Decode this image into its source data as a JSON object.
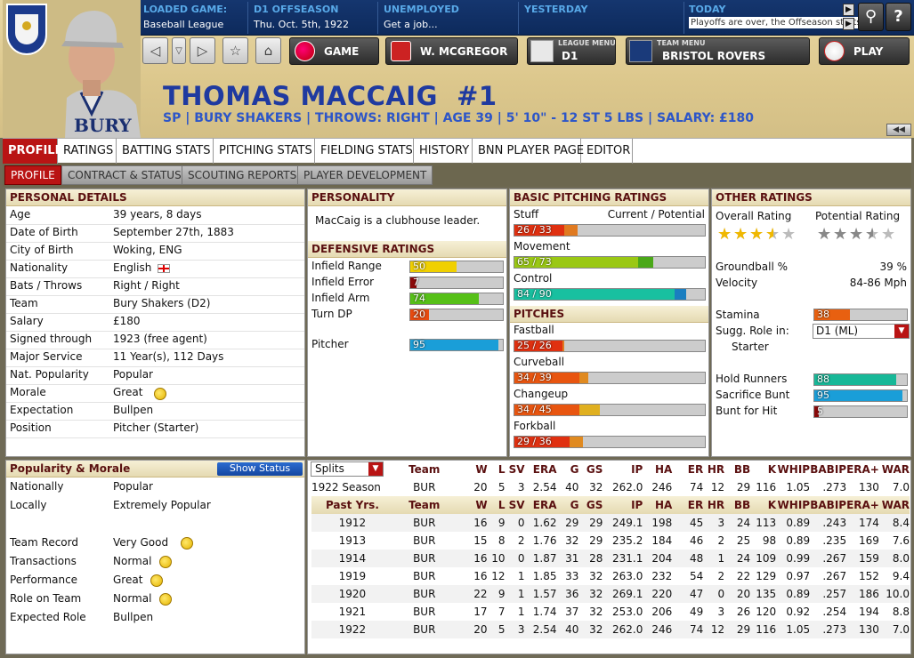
{
  "header": {
    "loaded_game_label": "LOADED GAME:",
    "loaded_game_value": "Baseball League",
    "season_label": "D1 OFFSEASON",
    "season_value": "Thu. Oct. 5th, 1922",
    "status_label": "UNEMPLOYED",
    "status_value": "Get a job...",
    "yesterday_label": "YESTERDAY",
    "today_label": "TODAY",
    "today_value": "Playoffs are over, the Offseason starts"
  },
  "nav": {
    "game": "GAME",
    "manager": "W. MCGREGOR",
    "league_menu_label": "LEAGUE MENU",
    "league_menu_value": "D1",
    "team_menu_label": "TEAM MENU",
    "team_menu_value": "BRISTOL ROVERS",
    "play": "PLAY",
    "rewind": "◀◀"
  },
  "player": {
    "name": "THOMAS MACCAIG  #1",
    "subtitle": "SP | BURY SHAKERS | THROWS: RIGHT | AGE 39 | 5' 10\" - 12 ST 5 LBS | SALARY: £180",
    "jersey_text": "BURY"
  },
  "tabs": [
    "PROFILE",
    "RATINGS",
    "BATTING STATS",
    "PITCHING STATS",
    "FIELDING STATS",
    "HISTORY",
    "BNN PLAYER PAGE",
    "EDITOR"
  ],
  "subtabs": [
    "PROFILE",
    "CONTRACT & STATUS",
    "SCOUTING REPORTS",
    "PLAYER DEVELOPMENT"
  ],
  "personal": {
    "title": "PERSONAL DETAILS",
    "rows": [
      [
        "Age",
        "39 years, 8 days"
      ],
      [
        "Date of Birth",
        "September 27th, 1883"
      ],
      [
        "City of Birth",
        "Woking, ENG"
      ],
      [
        "Nationality",
        "English"
      ],
      [
        "Bats / Throws",
        "Right / Right"
      ],
      [
        "Team",
        "Bury Shakers (D2)"
      ],
      [
        "Salary",
        "£180"
      ],
      [
        "Signed through",
        "1923 (free agent)"
      ],
      [
        "Major Service",
        "11 Year(s), 112 Days"
      ],
      [
        "Nat. Popularity",
        "Popular"
      ],
      [
        "Morale",
        "Great"
      ],
      [
        "Expectation",
        "Bullpen"
      ],
      [
        "Position",
        "Pitcher (Starter)"
      ]
    ]
  },
  "personality": {
    "title": "PERSONALITY",
    "text": "MacCaig is a clubhouse leader."
  },
  "defensive": {
    "title": "DEFENSIVE RATINGS",
    "rows": [
      {
        "label": "Infield Range",
        "value": "50",
        "pct": 0.5,
        "color": "#f0d000"
      },
      {
        "label": "Infield Error",
        "value": "7",
        "pct": 0.07,
        "color": "#8a0a0a"
      },
      {
        "label": "Infield Arm",
        "value": "74",
        "pct": 0.74,
        "color": "#56c018"
      },
      {
        "label": "Turn DP",
        "value": "20",
        "pct": 0.2,
        "color": "#e84b10"
      },
      {
        "label": "Pitcher",
        "value": "95",
        "pct": 0.95,
        "color": "#1a9ed8"
      }
    ]
  },
  "pitching": {
    "title": "BASIC PITCHING RATINGS",
    "cp_label": "Current / Potential",
    "rows": [
      {
        "label": "Stuff",
        "value": "26 / 33",
        "cur": 0.26,
        "pot": 0.33,
        "color": "#e03010",
        "pcolor": "#e07a20"
      },
      {
        "label": "Movement",
        "value": "65 / 73",
        "cur": 0.65,
        "pot": 0.73,
        "color": "#9ac814",
        "pcolor": "#4aa818"
      },
      {
        "label": "Control",
        "value": "84 / 90",
        "cur": 0.84,
        "pot": 0.9,
        "color": "#18c0a0",
        "pcolor": "#1a7ec0"
      }
    ]
  },
  "pitches": {
    "title": "PITCHES",
    "rows": [
      {
        "label": "Fastball",
        "value": "25 / 26",
        "cur": 0.25,
        "pot": 0.26,
        "color": "#e03010",
        "pcolor": "#e07a20"
      },
      {
        "label": "Curveball",
        "value": "34 / 39",
        "cur": 0.34,
        "pot": 0.39,
        "color": "#e85510",
        "pcolor": "#e08a20"
      },
      {
        "label": "Changeup",
        "value": "34 / 45",
        "cur": 0.34,
        "pot": 0.45,
        "color": "#e85510",
        "pcolor": "#e0b020"
      },
      {
        "label": "Forkball",
        "value": "29 / 36",
        "cur": 0.29,
        "pot": 0.36,
        "color": "#e03010",
        "pcolor": "#e08a20"
      }
    ]
  },
  "other": {
    "title": "OTHER RATINGS",
    "overall_label": "Overall Rating",
    "potential_label": "Potential Rating",
    "overall_stars": 3.5,
    "potential_stars": 3.5,
    "groundball_label": "Groundball %",
    "groundball_value": "39 %",
    "velocity_label": "Velocity",
    "velocity_value": "84-86 Mph",
    "stamina_label": "Stamina",
    "stamina_value": "38",
    "stamina_pct": 0.38,
    "role_label": "Sugg. Role in:",
    "role_select": "D1 (ML)",
    "role_value": "Starter",
    "bars": [
      {
        "label": "Hold Runners",
        "value": "88",
        "pct": 0.88,
        "color": "#18b898"
      },
      {
        "label": "Sacrifice Bunt",
        "value": "95",
        "pct": 0.95,
        "color": "#1a9ed8"
      },
      {
        "label": "Bunt for Hit",
        "value": "5",
        "pct": 0.05,
        "color": "#8a0a0a"
      }
    ]
  },
  "popularity": {
    "title": "Popularity & Morale",
    "button": "Show Status",
    "rows": [
      [
        "Nationally",
        "Popular",
        ""
      ],
      [
        "Locally",
        "Extremely Popular",
        ""
      ],
      [
        "Team Record",
        "Very Good",
        "smile"
      ],
      [
        "Transactions",
        "Normal",
        "smile"
      ],
      [
        "Performance",
        "Great",
        "smile"
      ],
      [
        "Role on Team",
        "Normal",
        "smile"
      ],
      [
        "Expected Role",
        "Bullpen",
        ""
      ]
    ]
  },
  "stats": {
    "splits": "Splits",
    "headers": [
      "Team",
      "W",
      "L",
      "SV",
      "ERA",
      "G",
      "GS",
      "IP",
      "HA",
      "ER",
      "HR",
      "BB",
      "K",
      "WHIP",
      "BABIP",
      "ERA+",
      "WAR"
    ],
    "season_label": "1922 Season",
    "season": [
      "BUR",
      "20",
      "5",
      "3",
      "2.54",
      "40",
      "32",
      "262.0",
      "246",
      "74",
      "12",
      "29",
      "116",
      "1.05",
      ".273",
      "130",
      "7.0"
    ],
    "past_label": "Past Yrs.",
    "past": [
      [
        "1912",
        "BUR",
        "16",
        "9",
        "0",
        "1.62",
        "29",
        "29",
        "249.1",
        "198",
        "45",
        "3",
        "24",
        "113",
        "0.89",
        ".243",
        "174",
        "8.4"
      ],
      [
        "1913",
        "BUR",
        "15",
        "8",
        "2",
        "1.76",
        "32",
        "29",
        "235.2",
        "184",
        "46",
        "2",
        "25",
        "98",
        "0.89",
        ".235",
        "169",
        "7.6"
      ],
      [
        "1914",
        "BUR",
        "16",
        "10",
        "0",
        "1.87",
        "31",
        "28",
        "231.1",
        "204",
        "48",
        "1",
        "24",
        "109",
        "0.99",
        ".267",
        "159",
        "8.0"
      ],
      [
        "1919",
        "BUR",
        "16",
        "12",
        "1",
        "1.85",
        "33",
        "32",
        "263.0",
        "232",
        "54",
        "2",
        "22",
        "129",
        "0.97",
        ".267",
        "152",
        "9.4"
      ],
      [
        "1920",
        "BUR",
        "22",
        "9",
        "1",
        "1.57",
        "36",
        "32",
        "269.1",
        "220",
        "47",
        "0",
        "20",
        "135",
        "0.89",
        ".257",
        "186",
        "10.0"
      ],
      [
        "1921",
        "BUR",
        "17",
        "7",
        "1",
        "1.74",
        "37",
        "32",
        "253.0",
        "206",
        "49",
        "3",
        "26",
        "120",
        "0.92",
        ".254",
        "194",
        "8.8"
      ],
      [
        "1922",
        "BUR",
        "20",
        "5",
        "3",
        "2.54",
        "40",
        "32",
        "262.0",
        "246",
        "74",
        "12",
        "29",
        "116",
        "1.05",
        ".273",
        "130",
        "7.0"
      ]
    ]
  }
}
